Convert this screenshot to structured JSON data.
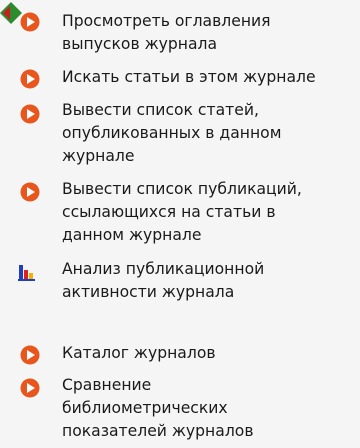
{
  "colors": {
    "background": "#f5f5f5",
    "text": "#1a1a1a",
    "bullet_orange": "#e8561e",
    "bullet_white": "#ffffff",
    "marker_green": "#2e8b2e",
    "marker_red": "#c81e1e"
  },
  "menu": {
    "items": [
      {
        "label_lines": [
          "Просмотреть оглавления",
          "выпусков журнала"
        ],
        "icon": "orange-play-bullet-icon"
      },
      {
        "label_lines": [
          "Искать статьи в этом журнале"
        ],
        "icon": "orange-play-bullet-icon"
      },
      {
        "label_lines": [
          "Вывести список статей,",
          "опубликованных в данном",
          "журнале"
        ],
        "icon": "orange-play-bullet-icon"
      },
      {
        "label_lines": [
          "Вывести список публикаций,",
          "ссылающихся на статьи в",
          "данном журнале"
        ],
        "icon": "orange-play-bullet-icon"
      },
      {
        "label_lines": [
          "Анализ публикационной",
          "активности журнала"
        ],
        "icon": "bar-chart-icon"
      },
      {
        "label_lines": [
          "Каталог журналов"
        ],
        "icon": "orange-play-bullet-icon"
      },
      {
        "label_lines": [
          "Сравнение",
          "библиометрических",
          "показателей журналов"
        ],
        "icon": "orange-play-bullet-icon"
      }
    ]
  }
}
